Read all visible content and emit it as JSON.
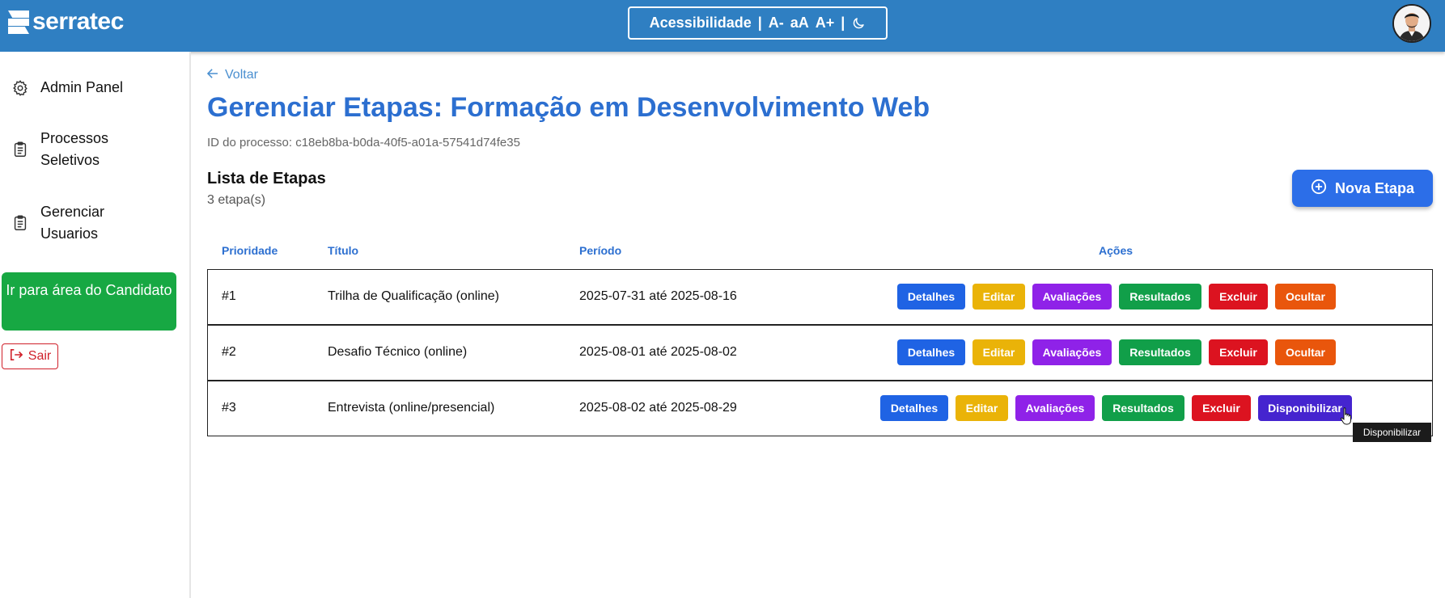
{
  "header": {
    "logo_text": "serratec",
    "accessibility": {
      "label": "Acessibilidade",
      "separator": "|",
      "decrease": "A-",
      "reset": "aA",
      "increase": "A+",
      "theme_icon": "moon-icon"
    },
    "avatar_icon": "user-avatar"
  },
  "sidebar": {
    "items": [
      {
        "label": "Admin Panel",
        "icon": "gear-icon"
      },
      {
        "label": "Processos Seletivos",
        "icon": "clipboard-icon"
      },
      {
        "label": "Gerenciar Usuarios",
        "icon": "clipboard-icon"
      }
    ],
    "candidate_button": "Ir para área do Candidato",
    "logout": "Sair"
  },
  "main": {
    "back": "Voltar",
    "title": "Gerenciar Etapas: Formação em Desenvolvimento Web",
    "process_id": "ID do processo: c18eb8ba-b0da-40f5-a01a-57541d74fe35",
    "list_title": "Lista de Etapas",
    "list_count": "3 etapa(s)",
    "new_button": "Nova Etapa",
    "columns": {
      "priority": "Prioridade",
      "title": "Título",
      "period": "Período",
      "actions": "Ações"
    },
    "rows": [
      {
        "priority": "#1",
        "title": "Trilha de Qualificação (online)",
        "period": "2025-07-31 até 2025-08-16",
        "last_action": "Ocultar"
      },
      {
        "priority": "#2",
        "title": "Desafio Técnico (online)",
        "period": "2025-08-01 até 2025-08-02",
        "last_action": "Ocultar"
      },
      {
        "priority": "#3",
        "title": "Entrevista (online/presencial)",
        "period": "2025-08-02 até 2025-08-29",
        "last_action": "Disponibilizar"
      }
    ],
    "action_labels": {
      "details": "Detalhes",
      "edit": "Editar",
      "evaluations": "Avaliações",
      "results": "Resultados",
      "delete": "Excluir"
    },
    "tooltip": "Disponibilizar"
  },
  "colors": {
    "header_bg": "#2f7fc2",
    "title_blue": "#2c6fd0",
    "candidate_green": "#17a843",
    "details": "#1f63e4",
    "edit": "#eab308",
    "evaluations": "#8f22e8",
    "results": "#119f49",
    "delete": "#dc1320",
    "hide": "#e9560c",
    "publish": "#4524cf"
  }
}
